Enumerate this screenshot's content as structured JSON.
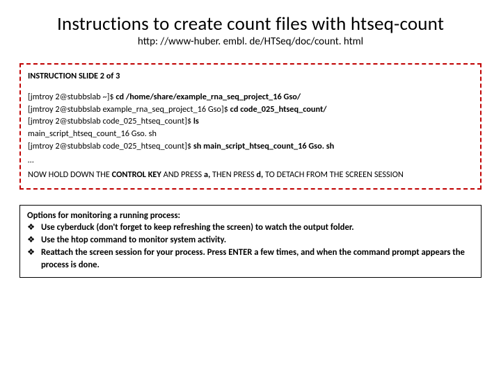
{
  "title": "Instructions to create count files with htseq-count",
  "subtitle": "http: //www-huber. embl. de/HTSeq/doc/count. html",
  "slide_label": "INSTRUCTION SLIDE 2 of 3",
  "term": {
    "l1_prompt": "[jmtroy 2@stubbslab ~]$ ",
    "l1_cmd": "cd /home/share/example_rna_seq_project_16 Gso/",
    "l2_prompt": "[jmtroy 2@stubbslab example_rna_seq_project_16 Gso]$ ",
    "l2_cmd": "cd code_025_htseq_count/",
    "l3_prompt": "[jmtroy 2@stubbslab code_025_htseq_count]$ ",
    "l3_cmd": "ls",
    "l4": "main_script_htseq_count_16 Gso. sh",
    "l5_prompt": "[jmtroy 2@stubbslab code_025_htseq_count]$ ",
    "l5_cmd": "sh  main_script_htseq_count_16 Gso. sh",
    "ellipsis": "…",
    "detach_a": "NOW HOLD DOWN THE ",
    "detach_b": "CONTROL KEY ",
    "detach_c": "AND PRESS ",
    "detach_d": "a, ",
    "detach_e": "THEN PRESS ",
    "detach_f": "d, ",
    "detach_g": "TO DETACH FROM THE SCREEN SESSION"
  },
  "options": {
    "header": "Options for monitoring a running process:",
    "bullet_mark": "❖",
    "items": [
      "Use cyberduck (don't forget to keep refreshing the screen) to watch the output folder.",
      "Use the htop command to monitor system activity.",
      "Reattach the screen session for your process.  Press ENTER a few times, and when the command prompt appears the process is done."
    ]
  }
}
